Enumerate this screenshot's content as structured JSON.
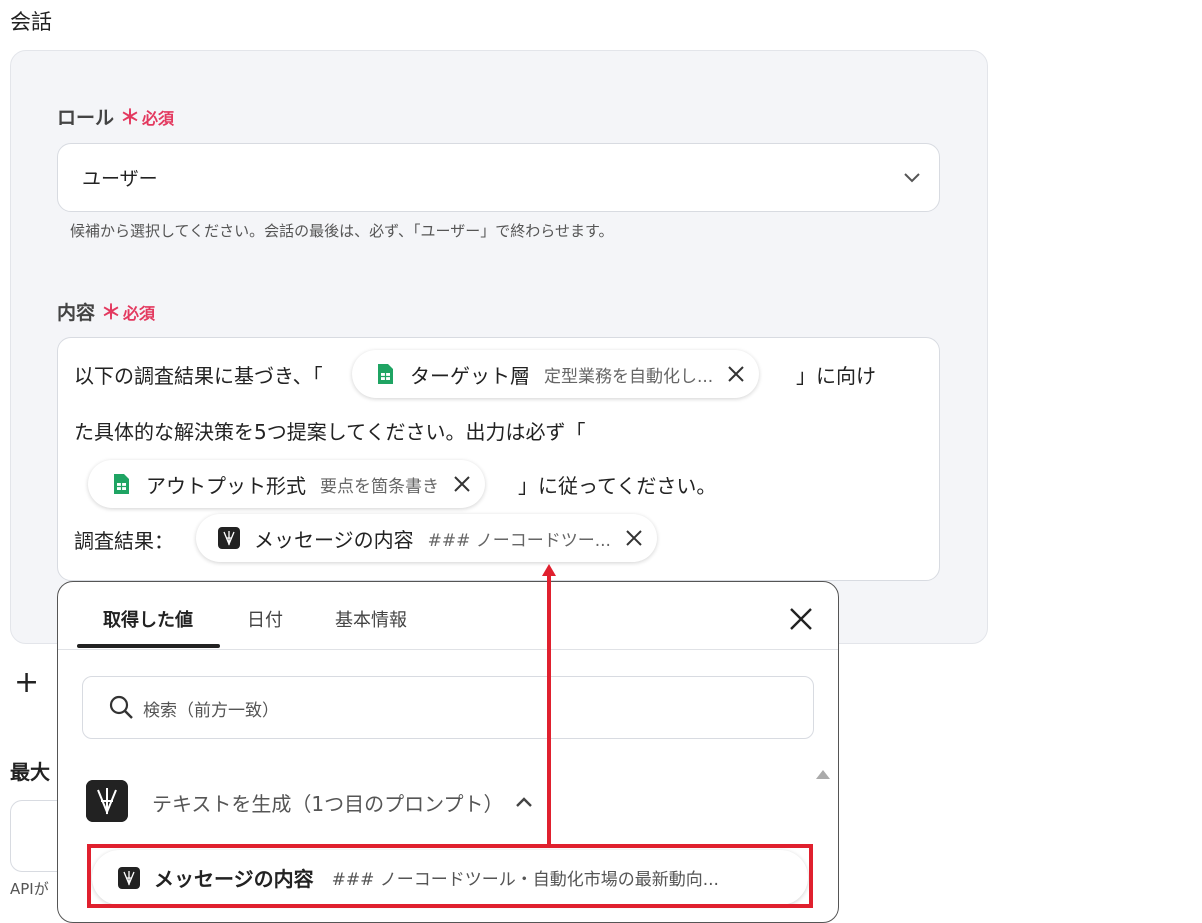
{
  "section_title": "会話",
  "role": {
    "label": "ロール",
    "required_star": "＊",
    "required_text": "必須",
    "value": "ユーザー",
    "hint": "候補から選択してください。会話の最後は、必ず、「ユーザー」で終わらせます。"
  },
  "content": {
    "label": "内容",
    "required_star": "＊",
    "required_text": "必須",
    "line1_before": "以下の調査結果に基づき、「",
    "chip1_name": "ターゲット層",
    "chip1_preview": "定型業務を自動化し...",
    "line1_after": "」に向け",
    "line2": "た具体的な解決策を5つ提案してください。出力は必ず「",
    "chip2_name": "アウトプット形式",
    "chip2_preview": "要点を箇条書き",
    "line3_after": "」に従ってください。",
    "line4_before": "調査結果：",
    "chip3_name": "メッセージの内容",
    "chip3_preview": "### ノーコードツー..."
  },
  "add_symbol": "+",
  "cut_label": "最大",
  "cut_api": "APIが",
  "popup": {
    "tabs": [
      "取得した値",
      "日付",
      "基本情報"
    ],
    "search_placeholder": "検索（前方一致）",
    "group_label": "テキストを生成（1つ目のプロンプト）",
    "result_name": "メッセージの内容",
    "result_preview": "### ノーコードツール・自動化市場の最新動向..."
  },
  "colors": {
    "required": "#e3395f",
    "highlight": "#e0202e",
    "sheets_green": "#1fa463"
  },
  "icons": [
    "chevron-down-icon",
    "sheets-icon",
    "close-icon",
    "ai-app-icon",
    "search-icon",
    "chevron-up-icon",
    "plus-icon"
  ]
}
